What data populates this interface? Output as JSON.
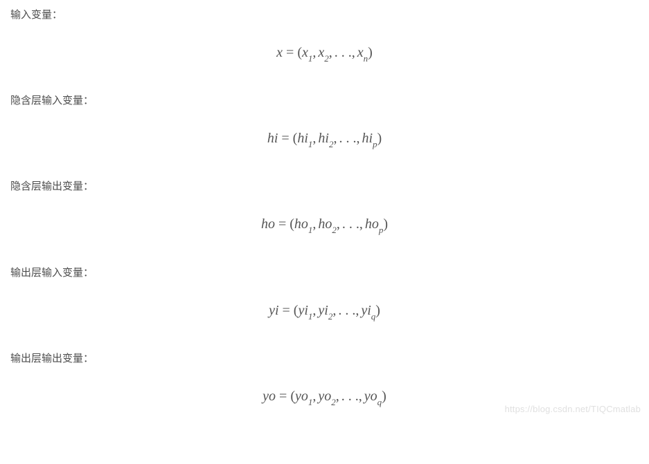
{
  "sections": [
    {
      "label": "输入变量：",
      "var": "x",
      "elem_base": "x",
      "idx1": "1",
      "idx2": "2",
      "idxN": "n"
    },
    {
      "label": "隐含层输入变量：",
      "var": "hi",
      "elem_base": "hi",
      "idx1": "1",
      "idx2": "2",
      "idxN": "p"
    },
    {
      "label": "隐含层输出变量：",
      "var": "ho",
      "elem_base": "ho",
      "idx1": "1",
      "idx2": "2",
      "idxN": "p"
    },
    {
      "label": "输出层输入变量：",
      "var": "yi",
      "elem_base": "yi",
      "idx1": "1",
      "idx2": "2",
      "idxN": "q"
    },
    {
      "label": "输出层输出变量：",
      "var": "yo",
      "elem_base": "yo",
      "idx1": "1",
      "idx2": "2",
      "idxN": "q"
    }
  ],
  "symbols": {
    "eq": "=",
    "lparen": "(",
    "rparen": ")",
    "comma": ",",
    "ellipsis": ". . ."
  },
  "watermark": "https://blog.csdn.net/TIQCmatlab"
}
